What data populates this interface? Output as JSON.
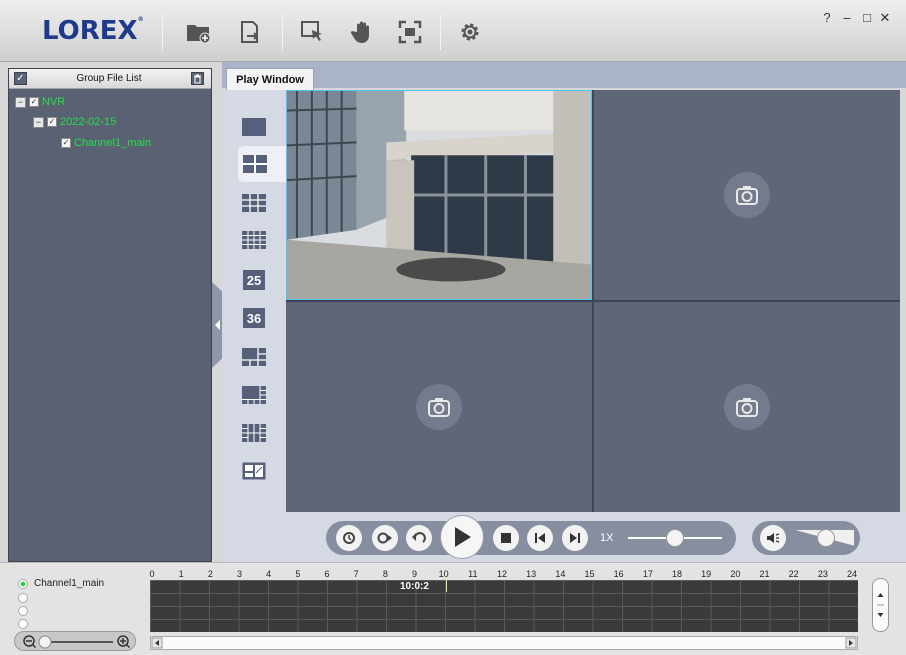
{
  "app": {
    "logo": "LOREX"
  },
  "toolbar": {
    "window_controls": [
      "?",
      "–",
      "□",
      "✕"
    ]
  },
  "left_panel": {
    "header_title": "Group File List",
    "tree": [
      {
        "label": "NVR",
        "level": 0
      },
      {
        "label": "2022-02-15",
        "level": 1
      },
      {
        "label": "Channel1_main",
        "level": 2
      }
    ]
  },
  "tabs": [
    {
      "label": "Play Window"
    }
  ],
  "layouts": {
    "count_25": "25",
    "count_36": "36"
  },
  "playback": {
    "speed_label": "1X"
  },
  "timeline": {
    "channel": "Channel1_main",
    "hours": [
      "0",
      "1",
      "2",
      "3",
      "4",
      "5",
      "6",
      "7",
      "8",
      "9",
      "10",
      "11",
      "12",
      "13",
      "14",
      "15",
      "16",
      "17",
      "18",
      "19",
      "20",
      "21",
      "22",
      "23",
      "24"
    ],
    "current_time": "10:0:2"
  },
  "colors": {
    "tree_text": "#22e04a",
    "logo": "#1e3a8a",
    "panel_bg": "#5a6173"
  }
}
